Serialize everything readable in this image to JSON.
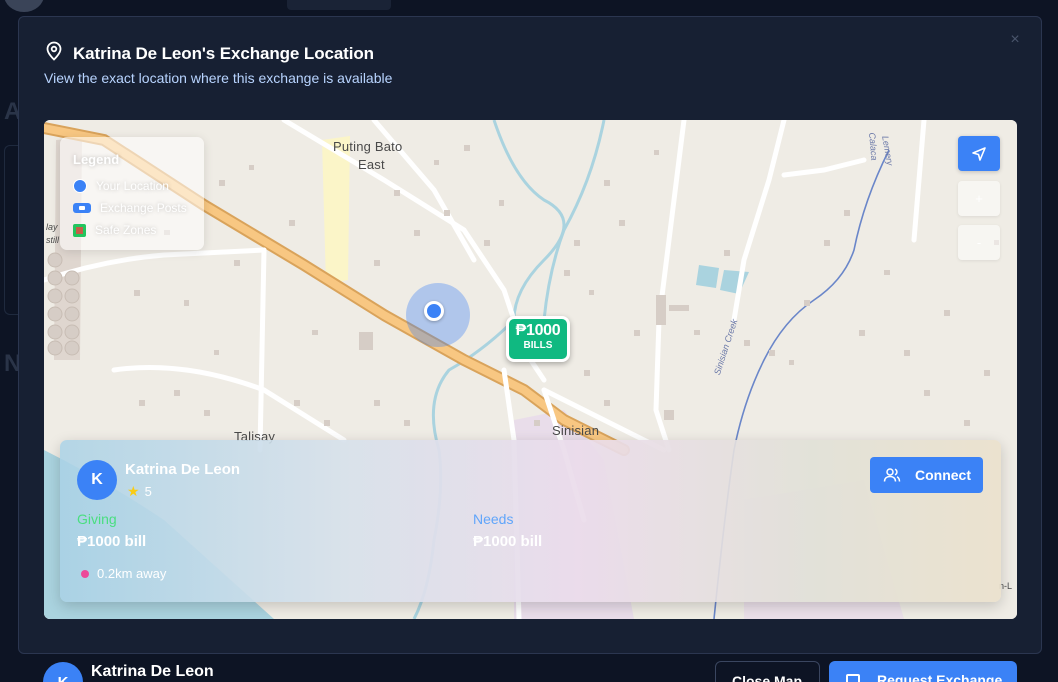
{
  "modal": {
    "title": "Katrina De Leon's Exchange Location",
    "subtitle": "View the exact location where this exchange is available",
    "close": "×"
  },
  "map": {
    "places": {
      "puting_bato": "Puting Bato",
      "east": "East",
      "talisay": "Talisay",
      "sinisian": "Sinisian",
      "sinisian_creek": "Sinisian Creek",
      "lemery": "Lemery",
      "calaca": "Calaca",
      "left_edge_1": "lay",
      "left_edge_2": "still",
      "right_edge": "n-L"
    },
    "legend": {
      "title": "Legend",
      "items": [
        "Your Location",
        "Exchange Posts",
        "Safe Zones"
      ]
    },
    "controls": {
      "zoom_in": "+",
      "zoom_out": "-"
    },
    "marker": {
      "amount": "₱1000",
      "type": "BILLS"
    }
  },
  "card": {
    "avatar_initial": "K",
    "name": "Katrina De Leon",
    "rating": "5",
    "connect_label": "Connect",
    "giving_label": "Giving",
    "giving_value": "₱1000 bill",
    "needs_label": "Needs",
    "needs_value": "₱1000 bill",
    "distance": "0.2km away"
  },
  "footer": {
    "avatar_initial": "K",
    "name": "Katrina De Leon",
    "close_map_label": "Close Map",
    "request_label": "Request Exchange"
  },
  "colors": {
    "accent": "#3b82f6",
    "marker": "#10b981",
    "giving": "#4ade80",
    "needs": "#60a5fa",
    "modal_bg": "#172033"
  }
}
